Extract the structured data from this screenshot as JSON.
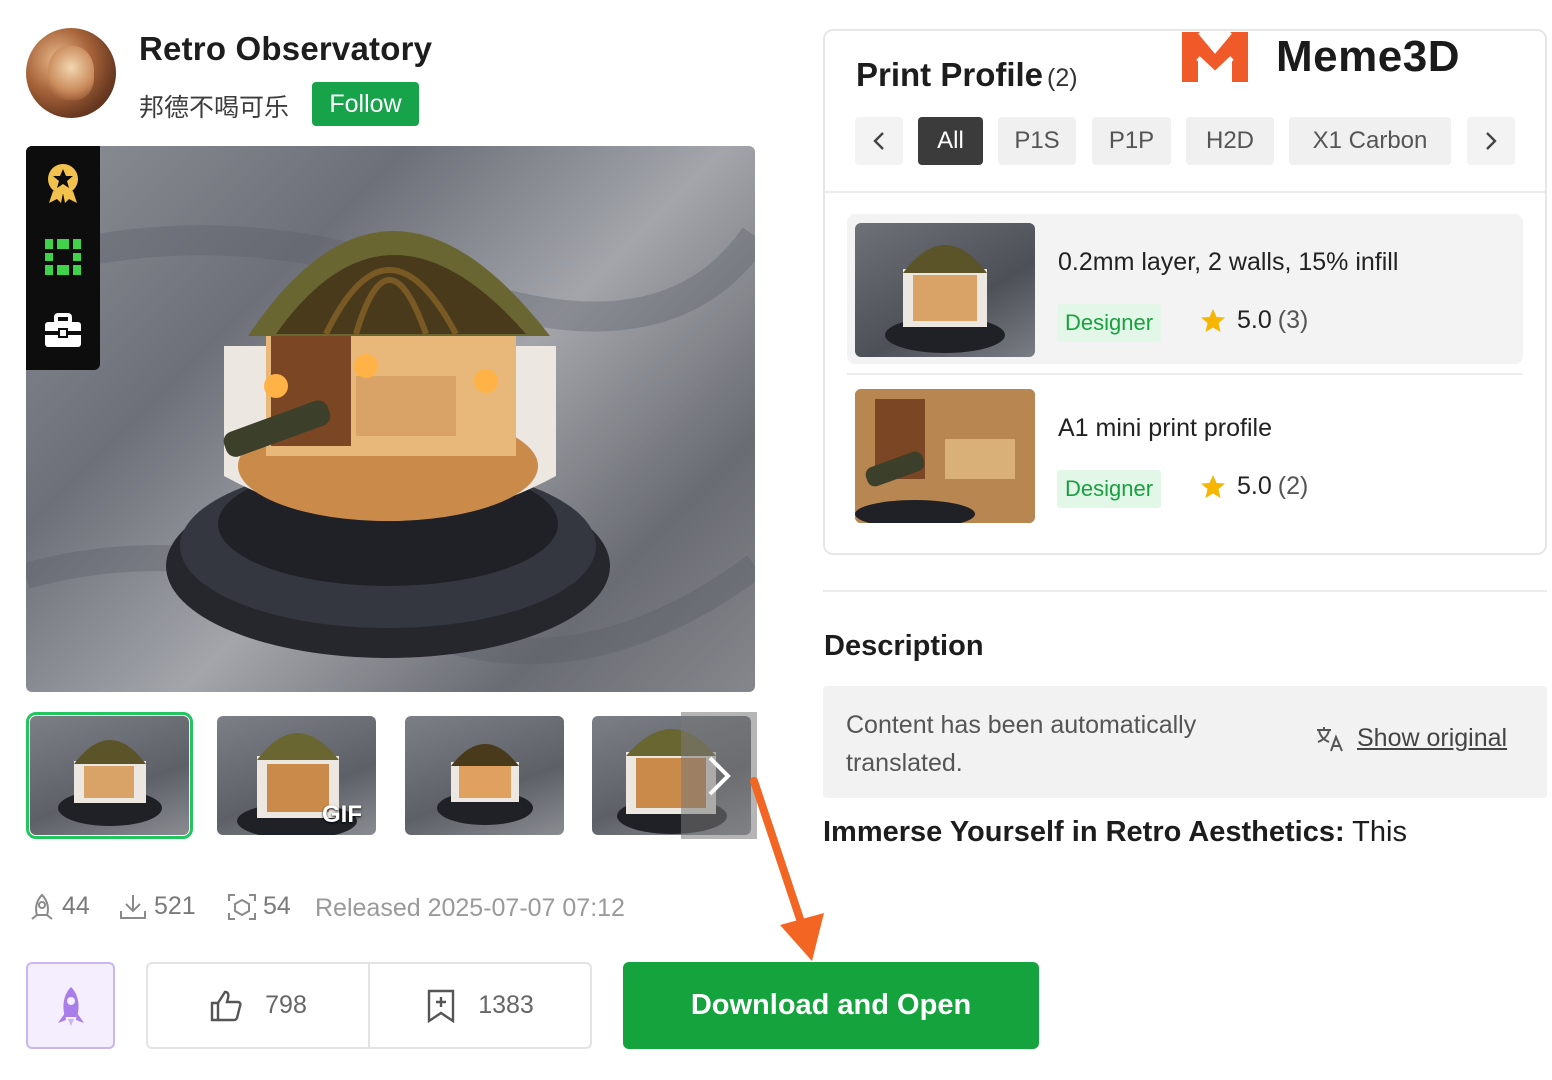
{
  "header": {
    "title": "Retro Observatory",
    "author": "邦德不喝可乐",
    "follow_label": "Follow"
  },
  "toolbar": {
    "icons": [
      "badge-icon",
      "ar-cube-icon",
      "toolbox-icon"
    ]
  },
  "gallery": {
    "thumbnails": [
      {
        "label": ""
      },
      {
        "label": "GIF"
      },
      {
        "label": ""
      },
      {
        "label": ""
      }
    ]
  },
  "stats": {
    "boosts": "44",
    "downloads": "521",
    "prints": "54",
    "released": "Released 2025-07-07 07:12"
  },
  "actions": {
    "likes": "798",
    "collects": "1383",
    "download_label": "Download and Open"
  },
  "print_profile": {
    "title": "Print Profile",
    "count": "(2)",
    "logo_text": "Meme3D",
    "filters": [
      "All",
      "P1S",
      "P1P",
      "H2D",
      "X1 Carbon"
    ],
    "active_filter": "All",
    "items": [
      {
        "name": "0.2mm layer, 2 walls, 15% infill",
        "tag": "Designer",
        "rating": "5.0",
        "rating_count": "(3)"
      },
      {
        "name": "A1 mini print profile",
        "tag": "Designer",
        "rating": "5.0",
        "rating_count": "(2)"
      }
    ]
  },
  "description": {
    "heading": "Description",
    "translate_note": "Content has been automatically translated.",
    "show_original": "Show original",
    "lead_bold": "Immerse Yourself in Retro Aesthetics:",
    "lead_rest": " This"
  },
  "colors": {
    "brand_green": "#15a33d",
    "logo_orange": "#f05a28",
    "annotation_arrow": "#f26522"
  }
}
